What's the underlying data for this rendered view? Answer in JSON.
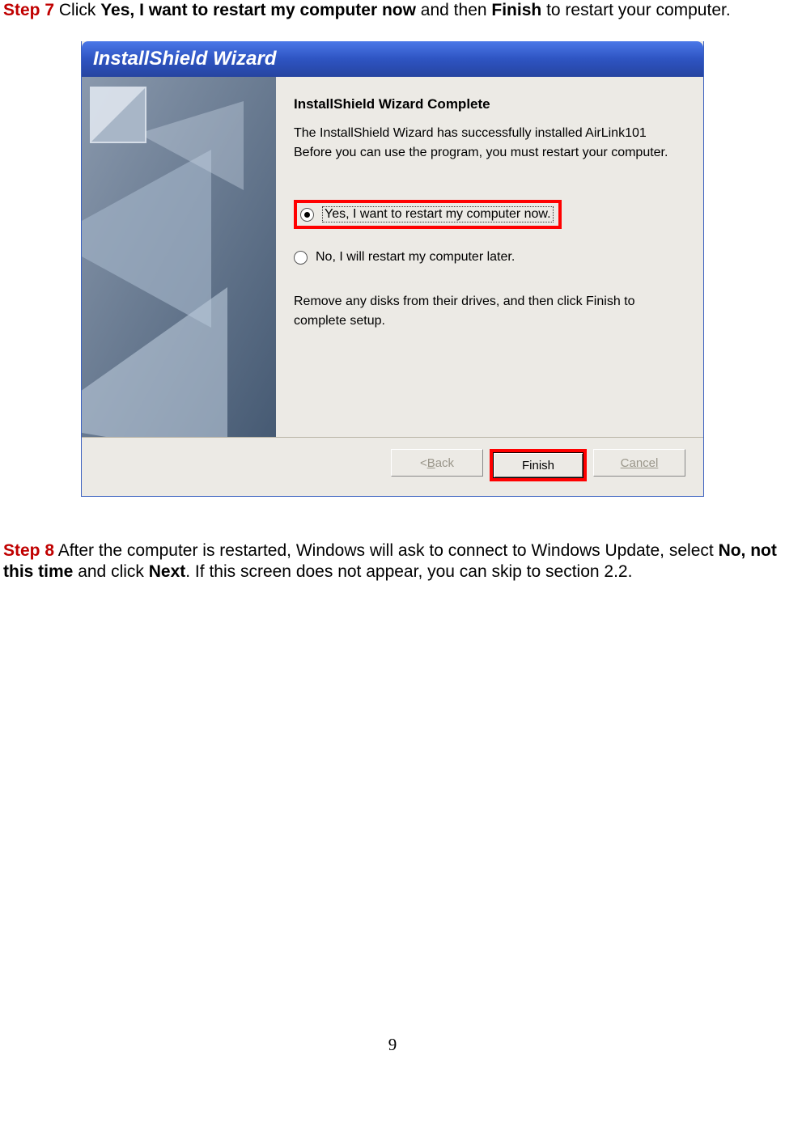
{
  "step7": {
    "label": "Step 7",
    "pre": " Click ",
    "bold1": "Yes, I want to restart my computer now",
    "mid": " and then ",
    "bold2": "Finish",
    "tail": " to restart your computer."
  },
  "wizard": {
    "title": "InstallShield Wizard",
    "heading": "InstallShield Wizard Complete",
    "line1": "The InstallShield Wizard has successfully installed AirLink101",
    "line2": "Before you can use the program, you must restart your computer.",
    "radio_yes": "Yes, I want to restart my computer now.",
    "radio_no": "No, I will restart my computer later.",
    "remove1": "Remove any disks from their drives, and then click Finish to",
    "remove2": "complete setup.",
    "back_pre": "< ",
    "back_u": "B",
    "back_post": "ack",
    "finish_label": "Finish",
    "cancel_label": "Cancel"
  },
  "step8": {
    "label": "Step 8",
    "t1": " After the computer is restarted, Windows will ask to connect to Windows Update, select ",
    "bold1": "No, not this time",
    "t2": " and click ",
    "bold2": "Next",
    "t3": ". If this screen does not appear, you can skip to section 2.2."
  },
  "page_number": "9"
}
